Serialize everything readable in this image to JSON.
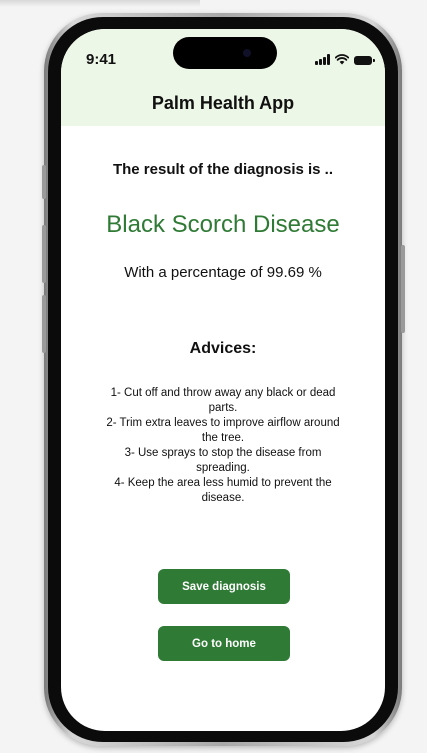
{
  "status_bar": {
    "time": "9:41",
    "icons": [
      "signal-icon",
      "wifi-icon",
      "battery-icon"
    ]
  },
  "header": {
    "title": "Palm Health App",
    "background_color": "#edf7e7"
  },
  "result": {
    "heading": "The result of the diagnosis is ..",
    "disease": "Black Scorch Disease",
    "percentage_text": "With a percentage of 99.69 %",
    "accent_color": "#2f7a35"
  },
  "advices": {
    "heading": "Advices:",
    "items": [
      "1- Cut off and throw away any black or dead parts.",
      "2- Trim extra leaves to improve airflow around the tree.",
      "3- Use sprays to stop the disease from spreading.",
      "4- Keep the area less humid to prevent the disease."
    ]
  },
  "buttons": {
    "save_label": "Save diagnosis",
    "home_label": "Go to home"
  }
}
